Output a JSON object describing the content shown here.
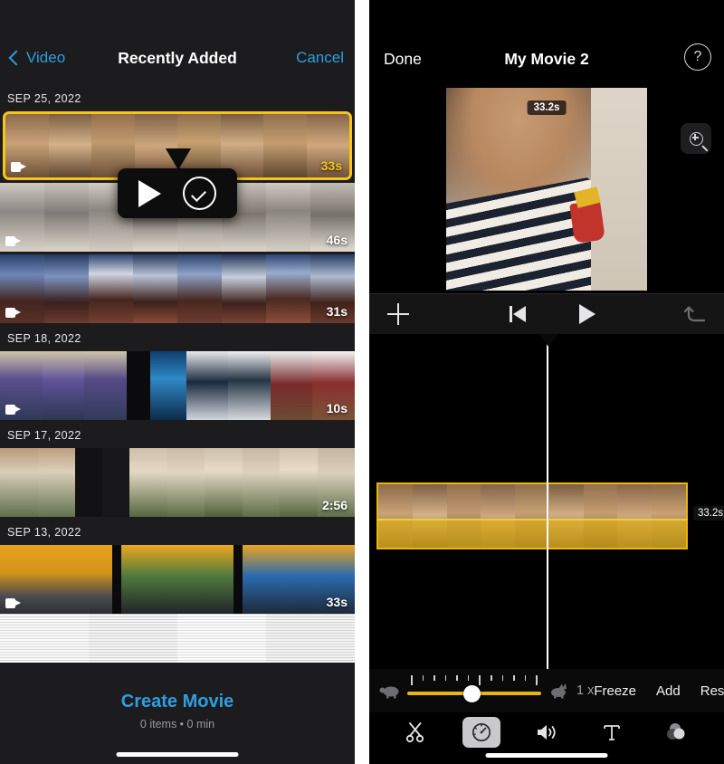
{
  "left_phone": {
    "nav": {
      "back_label": "Video",
      "title": "Recently Added",
      "cancel_label": "Cancel",
      "back_icon": "chevron-left-icon"
    },
    "sections": [
      {
        "date": "SEP 25, 2022",
        "clips": [
          {
            "duration": "33s",
            "selected": true,
            "video_badge": "video-camera-icon"
          },
          {
            "duration": "46s",
            "selected": false,
            "video_badge": "video-camera-icon"
          },
          {
            "duration": "31s",
            "selected": false,
            "video_badge": "video-camera-icon"
          }
        ]
      },
      {
        "date": "SEP 18, 2022",
        "clips": [
          {
            "duration": "10s",
            "selected": false,
            "video_badge": "video-camera-icon"
          }
        ]
      },
      {
        "date": "SEP 17, 2022",
        "clips": [
          {
            "duration": "2:56",
            "selected": false,
            "video_badge": "video-camera-icon"
          }
        ]
      },
      {
        "date": "SEP 13, 2022",
        "clips": [
          {
            "duration": "33s",
            "selected": false,
            "video_badge": "video-camera-icon"
          },
          {
            "duration": "",
            "selected": false,
            "video_badge": ""
          }
        ]
      }
    ],
    "popup": {
      "play_icon": "play-icon",
      "select_icon": "checkmark-circle-icon"
    },
    "footer": {
      "create_label": "Create Movie",
      "meta": "0 items • 0 min"
    },
    "colors": {
      "accent_blue": "#2f9ee0",
      "selection_yellow": "#f5c518",
      "background": "#1c1c1e"
    }
  },
  "right_phone": {
    "nav": {
      "done_label": "Done",
      "title": "My Movie 2",
      "help_icon": "question-mark-circle-icon",
      "help_label": "?"
    },
    "preview": {
      "time_badge": "33.2s",
      "zoom_icon": "magnifier-plus-icon"
    },
    "controls": {
      "add_icon": "plus-icon",
      "skip_start_icon": "skip-to-start-icon",
      "play_icon": "play-icon",
      "undo_icon": "undo-arrow-icon"
    },
    "timeline": {
      "clip_duration": "33.2s",
      "playhead_icon": "playhead-marker"
    },
    "speed": {
      "slow_icon": "turtle-icon",
      "fast_icon": "rabbit-icon",
      "rate_label": "1 x",
      "freeze_label": "Freeze",
      "add_label": "Add",
      "reset_label": "Reset"
    },
    "toolbar": [
      {
        "name": "cut-tool",
        "icon": "scissors-icon",
        "active": false
      },
      {
        "name": "speed-tool",
        "icon": "speedometer-icon",
        "active": true
      },
      {
        "name": "volume-tool",
        "icon": "speaker-icon",
        "active": false
      },
      {
        "name": "title-tool",
        "icon": "text-t-icon",
        "active": false
      },
      {
        "name": "filter-tool",
        "icon": "filters-icon",
        "active": false
      }
    ],
    "colors": {
      "clip_yellow": "#e8b60f",
      "background": "#000000"
    }
  }
}
